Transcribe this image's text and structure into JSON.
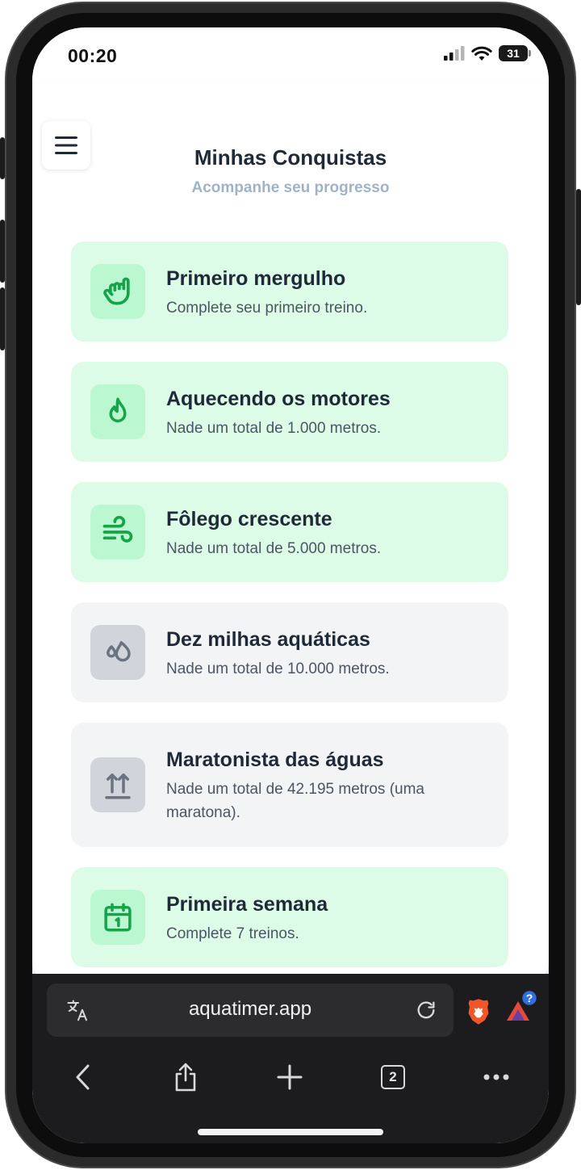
{
  "status_bar": {
    "time": "00:20",
    "battery": "31"
  },
  "header": {
    "title": "Minhas Conquistas",
    "subtitle": "Acompanhe seu progresso"
  },
  "achievements": [
    {
      "title": "Primeiro mergulho",
      "description": "Complete seu primeiro treino.",
      "status": "unlocked",
      "icon": "hand-rock-icon"
    },
    {
      "title": "Aquecendo os motores",
      "description": "Nade um total de 1.000 metros.",
      "status": "unlocked",
      "icon": "flame-icon"
    },
    {
      "title": "Fôlego crescente",
      "description": "Nade um total de 5.000 metros.",
      "status": "unlocked",
      "icon": "wind-icon"
    },
    {
      "title": "Dez milhas aquáticas",
      "description": "Nade um total de 10.000 metros.",
      "status": "locked",
      "icon": "droplets-icon"
    },
    {
      "title": "Maratonista das águas",
      "description": "Nade um total de 42.195 metros (uma maratona).",
      "status": "locked",
      "icon": "arrows-up-icon"
    },
    {
      "title": "Primeira semana",
      "description": "Complete 7 treinos.",
      "status": "unlocked",
      "icon": "calendar-icon"
    }
  ],
  "browser": {
    "url": "aquatimer.app",
    "tab_count": "2",
    "rewards_badge": "?"
  },
  "colors": {
    "unlocked_bg": "#dcfce7",
    "unlocked_icon_bg": "#bbf7d0",
    "unlocked_icon": "#16a34a",
    "locked_bg": "#f3f4f6",
    "locked_icon_bg": "#d1d5db",
    "locked_icon": "#6b7280"
  }
}
